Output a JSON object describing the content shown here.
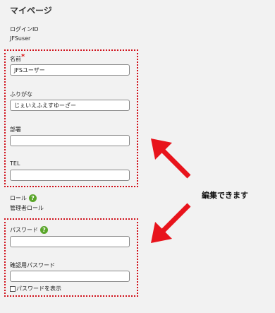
{
  "page": {
    "title": "マイページ"
  },
  "login": {
    "label": "ログインID",
    "value": "JFSuser"
  },
  "fields": {
    "name": {
      "label": "名前",
      "required_mark": "*",
      "value": "JFSユーザー"
    },
    "furigana": {
      "label": "ふりがな",
      "value": "じぇいえふえすゆーざー"
    },
    "department": {
      "label": "部署",
      "value": ""
    },
    "tel": {
      "label": "TEL",
      "value": ""
    }
  },
  "role": {
    "label": "ロール",
    "value": "管理者ロール",
    "help_glyph": "?"
  },
  "password": {
    "label": "パスワード",
    "help_glyph": "?",
    "value": ""
  },
  "password_confirm": {
    "label": "確認用パスワード",
    "value": "",
    "show_label": "パスワードを表示"
  },
  "annotation": {
    "text": "編集できます",
    "color": "#d0101a"
  },
  "colors": {
    "help_icon": "#5aa62a",
    "required": "#d11"
  }
}
